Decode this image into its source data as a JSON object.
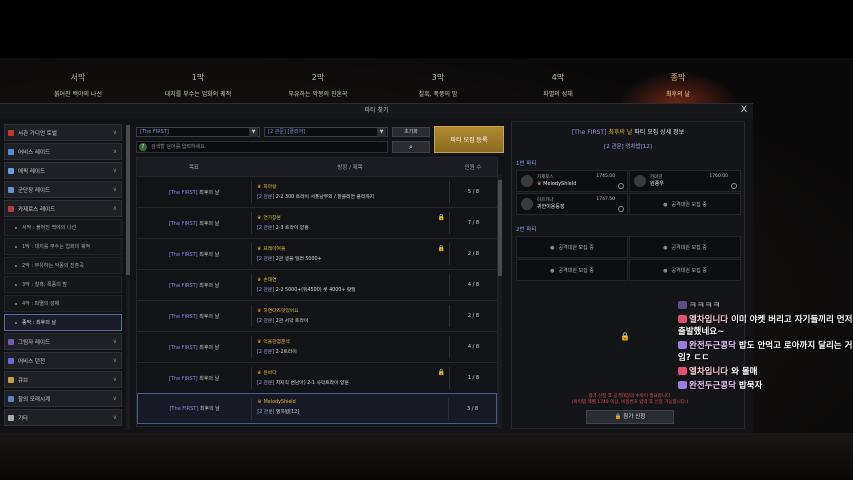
{
  "acts": [
    {
      "num": "서막",
      "sub": "붉어진 백야의 나선"
    },
    {
      "num": "1막",
      "sub": "대지를 부수는 업화의 궤적"
    },
    {
      "num": "2막",
      "sub": "부유하는 악몽의 진혼곡"
    },
    {
      "num": "3막",
      "sub": "칠흑, 폭풍의 밤"
    },
    {
      "num": "4막",
      "sub": "파멸의 성채"
    },
    {
      "num": "종막",
      "sub": "최후의 날"
    }
  ],
  "window": {
    "title": "파티 찾기",
    "close": "X"
  },
  "sidebar": {
    "items": [
      {
        "label": "서관 가디언 토벌",
        "color": "#c0392b"
      },
      {
        "label": "어비스 레이드",
        "color": "#5a8ad0"
      },
      {
        "label": "에픽 레이드",
        "color": "#6aa0e0"
      },
      {
        "label": "군단장 레이드",
        "color": "#6a90d0"
      },
      {
        "label": "카제로스 레이드",
        "color": "#b04040"
      }
    ],
    "subitems": [
      "서막 : 붉어진 백야의 나선",
      "1막 : 대지를 부수는 업화의 궤적",
      "2막 : 부유하는 악몽의 진혼곡",
      "3막 : 칠흑, 폭풍의 밤",
      "4막 : 파멸의 성채",
      "종막 : 최후의 날"
    ],
    "items2": [
      {
        "label": "그림자 레이드",
        "color": "#7a5ab0"
      },
      {
        "label": "어비스 던전",
        "color": "#6a6ad0"
      },
      {
        "label": "큐브",
        "color": "#c0a040"
      },
      {
        "label": "할의 모래시계",
        "color": "#6080c0"
      },
      {
        "label": "기타",
        "color": "#aaaaaa"
      }
    ]
  },
  "filters": {
    "raid": "[The FIRST]",
    "difficulty": "[2 관문] [클리어]",
    "search_placeholder": "검색할 단어를 입력하세요.",
    "reset": "초기화",
    "search_icon": "search-icon",
    "register": "파티 모집 등록"
  },
  "table": {
    "headers": [
      "목표",
      "방장 / 제목",
      "인원 수"
    ],
    "rows": [
      {
        "tag": "[The FIRST]",
        "goal": "최후의 날",
        "leader": "화마왕",
        "desc": "2-2 300 트라이 서폿남부외 / 잘클리면 클리까지",
        "level": "[2 관문]",
        "count": "5 / 8",
        "locked": false
      },
      {
        "tag": "[The FIRST]",
        "goal": "최후의 날",
        "leader": "연가창론",
        "desc": "2-3 트라이 양홍",
        "level": "[2 관문]",
        "count": "7 / 8",
        "locked": true
      },
      {
        "tag": "[The FIRST]",
        "goal": "최후의 날",
        "leader": "프레이여울",
        "desc": "2관 생물 딜러 5000+",
        "level": "[2 관문]",
        "count": "2 / 8",
        "locked": true
      },
      {
        "tag": "[The FIRST]",
        "goal": "최후의 날",
        "leader": "손태연",
        "desc": "2-2 5000+(뒤4500)  롯 4000+ 랏딜",
        "level": "[2 관문]",
        "count": "4 / 8",
        "locked": false
      },
      {
        "tag": "[The FIRST]",
        "goal": "최후의 날",
        "leader": "하연다즈맛있어요",
        "desc": "2관 서막 트라이",
        "level": "[2 관문]",
        "count": "2 / 8",
        "locked": false
      },
      {
        "tag": "[The FIRST]",
        "goal": "최후의 날",
        "leader": "억울한염준석",
        "desc": "2-2트라이",
        "level": "[2 관문]",
        "count": "4 / 8",
        "locked": false
      },
      {
        "tag": "[The FIRST]",
        "goal": "최후의 날",
        "leader": "윤바다",
        "desc": "치지직 변남아) 2-1 사막트라이 양훈",
        "level": "[2 관문]",
        "count": "1 / 8",
        "locked": true
      },
      {
        "tag": "[The FIRST]",
        "goal": "최후의 날",
        "leader": "MelodyShield",
        "desc": "엉차밥[12]",
        "level": "[2 관문]",
        "count": "3 / 8",
        "locked": false
      }
    ]
  },
  "detail": {
    "tag": "[The FIRST]",
    "event": "최후의 날",
    "title_suffix": "파티 모집 상세 정보",
    "subtitle": "[2 관문] 엉차밥[12]",
    "party1": "1번 파티",
    "party2": "2번 파티",
    "members": [
      {
        "class": "카제로스",
        "name": "MelodyShield",
        "ilvl": "1745.00"
      },
      {
        "class": "카이란",
        "name": "원종우",
        "ilvl": "1760.00"
      },
      {
        "class": "아르카나",
        "name": "귀한이용등장",
        "ilvl": "1747.50"
      }
    ],
    "empty": "공격대원 모집 중",
    "note1": "참가 신청 후 공격대장의 수락이 필요합니다.",
    "note2": "(아이템 레벨 1740 이상, 비밀번호 입력 후 신청 가능합니다.)",
    "apply": "참가 신청"
  },
  "chat": [
    {
      "user": "",
      "msg": "ㅋㅋㅋㅋ",
      "heart": "#9b7be0",
      "faded": true
    },
    {
      "user": "엘차입니다",
      "msg": "이미 야켓 버리고 자기들끼리 먼저 출발했네요~",
      "heart": "#e05070"
    },
    {
      "user": "완전두근콩닥",
      "msg": "밥도 안먹고 로아까지 달리는 거임? ㄷㄷ",
      "heart": "#9b7be0"
    },
    {
      "user": "엘차입니다",
      "msg": "와 몰매",
      "heart": "#e05070"
    },
    {
      "user": "완전두근콩닥",
      "msg": "밥묵자",
      "heart": "#9b7be0"
    }
  ]
}
